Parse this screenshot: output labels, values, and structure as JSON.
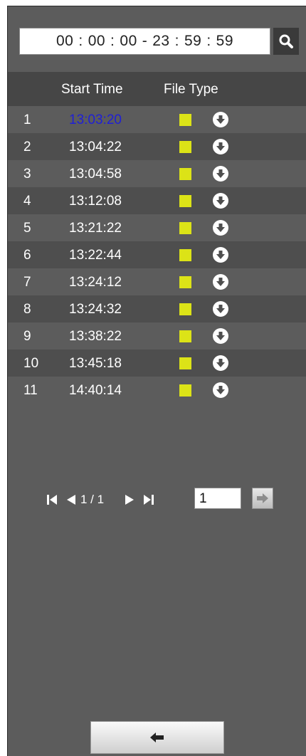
{
  "time_range": {
    "start": [
      "00",
      "00",
      "00"
    ],
    "dash": "-",
    "end": [
      "23",
      "59",
      "59"
    ],
    "separator": ":"
  },
  "search_button": {
    "icon": "search-icon"
  },
  "table": {
    "headers": {
      "start_time": "Start Time",
      "file_type": "File Type"
    },
    "rows": [
      {
        "num": "1",
        "time": "13:03:20",
        "selected": true
      },
      {
        "num": "2",
        "time": "13:04:22"
      },
      {
        "num": "3",
        "time": "13:04:58"
      },
      {
        "num": "4",
        "time": "13:12:08"
      },
      {
        "num": "5",
        "time": "13:21:22"
      },
      {
        "num": "6",
        "time": "13:22:44"
      },
      {
        "num": "7",
        "time": "13:24:12"
      },
      {
        "num": "8",
        "time": "13:24:32"
      },
      {
        "num": "9",
        "time": "13:38:22"
      },
      {
        "num": "10",
        "time": "13:45:18"
      },
      {
        "num": "11",
        "time": "14:40:14"
      }
    ],
    "file_type_color": "#dce317",
    "selected_time_color": "#1f1fd6",
    "download_icon": "download-circle-icon"
  },
  "pager": {
    "page_info": "1 / 1",
    "page_input": "1",
    "icons": [
      "first-page-icon",
      "prev-page-icon",
      "next-page-icon",
      "last-page-icon",
      "go-arrow-icon"
    ]
  },
  "back_button": {
    "icon": "back-arrow-icon"
  }
}
